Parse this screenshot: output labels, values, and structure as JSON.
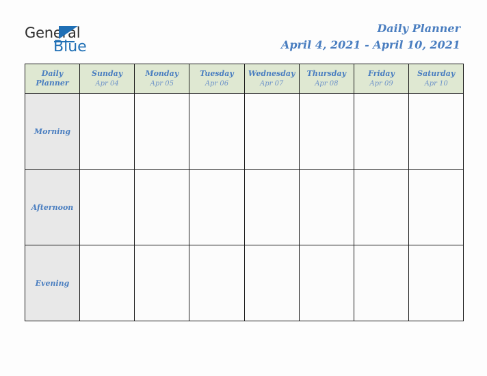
{
  "brand": {
    "word_one": "General",
    "word_two": "Blue",
    "accent_color": "#1f6fb5",
    "triangle_icon": "triangle-icon"
  },
  "header": {
    "title": "Daily Planner",
    "date_range": "April 4, 2021 - April 10, 2021",
    "title_color": "#4a7ec0"
  },
  "table": {
    "corner": {
      "line1": "Daily",
      "line2": "Planner"
    },
    "header_bg": "#dfe8d2",
    "label_bg": "#e8e8e8",
    "cell_bg": "#fcfcfc",
    "border_color": "#1a1a1a",
    "columns": [
      {
        "dayname": "Sunday",
        "date": "Apr 04"
      },
      {
        "dayname": "Monday",
        "date": "Apr 05"
      },
      {
        "dayname": "Tuesday",
        "date": "Apr 06"
      },
      {
        "dayname": "Wednesday",
        "date": "Apr 07"
      },
      {
        "dayname": "Thursday",
        "date": "Apr 08"
      },
      {
        "dayname": "Friday",
        "date": "Apr 09"
      },
      {
        "dayname": "Saturday",
        "date": "Apr 10"
      }
    ],
    "rows": [
      {
        "label": "Morning",
        "entries": [
          "",
          "",
          "",
          "",
          "",
          "",
          ""
        ]
      },
      {
        "label": "Afternoon",
        "entries": [
          "",
          "",
          "",
          "",
          "",
          "",
          ""
        ]
      },
      {
        "label": "Evening",
        "entries": [
          "",
          "",
          "",
          "",
          "",
          "",
          ""
        ]
      }
    ]
  }
}
